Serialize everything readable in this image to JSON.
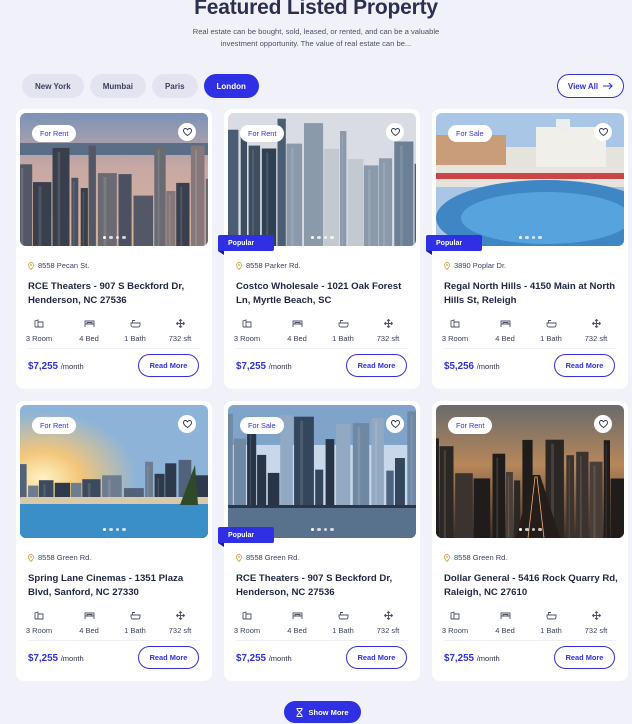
{
  "section": {
    "title": "Featured Listed Property",
    "subtitle": "Real estate can be bought, sold, leased, or rented, and can be a valuable investment opportunity. The value of real estate can be..."
  },
  "tabs": [
    {
      "label": "New York",
      "active": false
    },
    {
      "label": "Mumbai",
      "active": false
    },
    {
      "label": "Paris",
      "active": false
    },
    {
      "label": "London",
      "active": true
    }
  ],
  "view_all_label": "View All",
  "show_more_label": "Show More",
  "card_labels": {
    "read_more": "Read More",
    "popular": "Popular"
  },
  "properties": [
    {
      "tag": "For Rent",
      "popular": false,
      "address": "8558 Pecan St.",
      "name": "RCE Theaters - 907 S Beckford Dr, Henderson, NC 27536",
      "features": [
        "3 Room",
        "4 Bed",
        "1 Bath",
        "732 sft"
      ],
      "price": "$7,255",
      "unit": "/month",
      "image": "city-skyline-dusk"
    },
    {
      "tag": "For Rent",
      "popular": true,
      "address": "8558 Parker Rd.",
      "name": "Costco Wholesale - 1021 Oak Forest Ln, Myrtle Beach, SC",
      "features": [
        "3 Room",
        "4 Bed",
        "1 Bath",
        "732 sft"
      ],
      "price": "$7,255",
      "unit": "/month",
      "image": "glass-skyscrapers"
    },
    {
      "tag": "For Sale",
      "popular": true,
      "address": "3890 Poplar Dr.",
      "name": "Regal North Hills - 4150 Main at North Hills St, Releigh",
      "features": [
        "3 Room",
        "4 Bed",
        "1 Bath",
        "732 sft"
      ],
      "price": "$5,256",
      "unit": "/month",
      "image": "resort-pool"
    },
    {
      "tag": "For Rent",
      "popular": false,
      "address": "8558 Green Rd.",
      "name": "Spring Lane Cinemas - 1351 Plaza Blvd, Sanford, NC 27330",
      "features": [
        "3 Room",
        "4 Bed",
        "1 Bath",
        "732 sft"
      ],
      "price": "$7,255",
      "unit": "/month",
      "image": "sunset-pool-city"
    },
    {
      "tag": "For Sale",
      "popular": true,
      "address": "8558 Green Rd.",
      "name": "RCE Theaters - 907 S Beckford Dr, Henderson, NC 27536",
      "features": [
        "3 Room",
        "4 Bed",
        "1 Bath",
        "732 sft"
      ],
      "price": "$7,255",
      "unit": "/month",
      "image": "waterfront-towers"
    },
    {
      "tag": "For Rent",
      "popular": false,
      "address": "8558 Green Rd.",
      "name": "Dollar General - 5416 Rock Quarry Rd, Raleigh, NC 27610",
      "features": [
        "3 Room",
        "4 Bed",
        "1 Bath",
        "732 sft"
      ],
      "price": "$7,255",
      "unit": "/month",
      "image": "city-avenue-dusk"
    }
  ],
  "colors": {
    "accent": "#2f2fe4",
    "background": "#f1f2f9",
    "text": "#1f2544"
  },
  "icons": [
    "arrow-right-icon",
    "heart-icon",
    "map-pin-icon",
    "room-icon",
    "bed-icon",
    "bath-icon",
    "area-icon",
    "hourglass-icon"
  ]
}
